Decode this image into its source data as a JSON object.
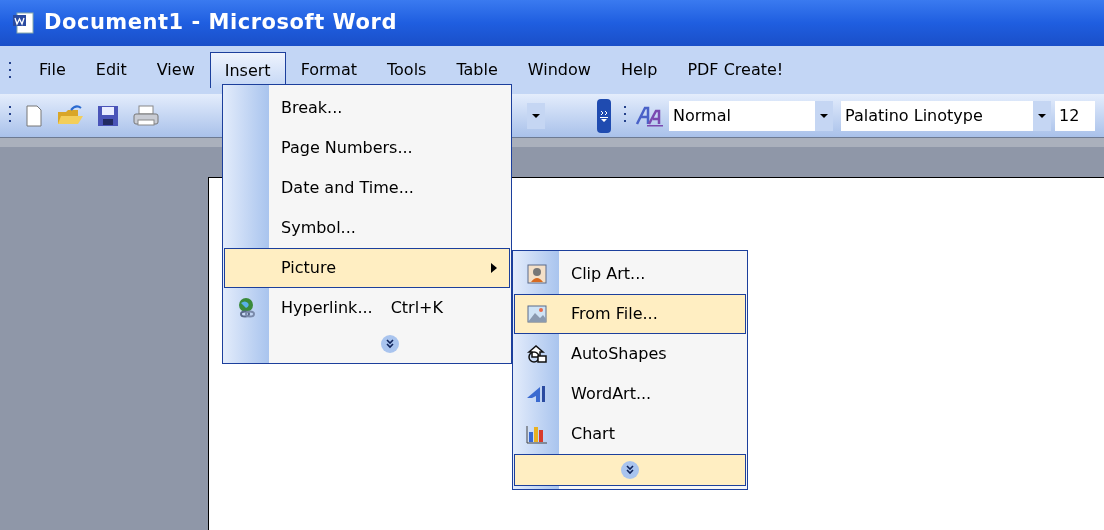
{
  "window": {
    "title": "Document1 - Microsoft Word"
  },
  "menu_bar": [
    {
      "label": "File",
      "selected": false
    },
    {
      "label": "Edit",
      "selected": false
    },
    {
      "label": "View",
      "selected": false
    },
    {
      "label": "Insert",
      "selected": true
    },
    {
      "label": "Format",
      "selected": false
    },
    {
      "label": "Tools",
      "selected": false
    },
    {
      "label": "Table",
      "selected": false
    },
    {
      "label": "Window",
      "selected": false
    },
    {
      "label": "Help",
      "selected": false
    },
    {
      "label": "PDF Create!",
      "selected": false
    }
  ],
  "toolbar": {
    "style": "Normal",
    "font": "Palatino Linotype",
    "size": "12"
  },
  "insert_menu": {
    "items": [
      {
        "label": "Break...",
        "selected": false,
        "kind": "plain"
      },
      {
        "label": "Page Numbers...",
        "selected": false,
        "kind": "plain"
      },
      {
        "label": "Date and Time...",
        "selected": false,
        "kind": "plain"
      },
      {
        "label": "Symbol...",
        "selected": false,
        "kind": "plain"
      },
      {
        "label": "Picture",
        "selected": true,
        "kind": "submenu"
      },
      {
        "label": "Hyperlink...",
        "shortcut": "Ctrl+K",
        "selected": false,
        "kind": "hyperlink"
      }
    ],
    "expand": {
      "selected": false
    }
  },
  "picture_submenu": {
    "items": [
      {
        "label": "Clip Art...",
        "selected": false,
        "kind": "clipart"
      },
      {
        "label": "From File...",
        "selected": true,
        "kind": "fromfile"
      },
      {
        "label": "AutoShapes",
        "selected": false,
        "kind": "autoshapes"
      },
      {
        "label": "WordArt...",
        "selected": false,
        "kind": "wordart"
      },
      {
        "label": "Chart",
        "selected": false,
        "kind": "chart"
      }
    ],
    "expand": {
      "selected": true
    }
  }
}
